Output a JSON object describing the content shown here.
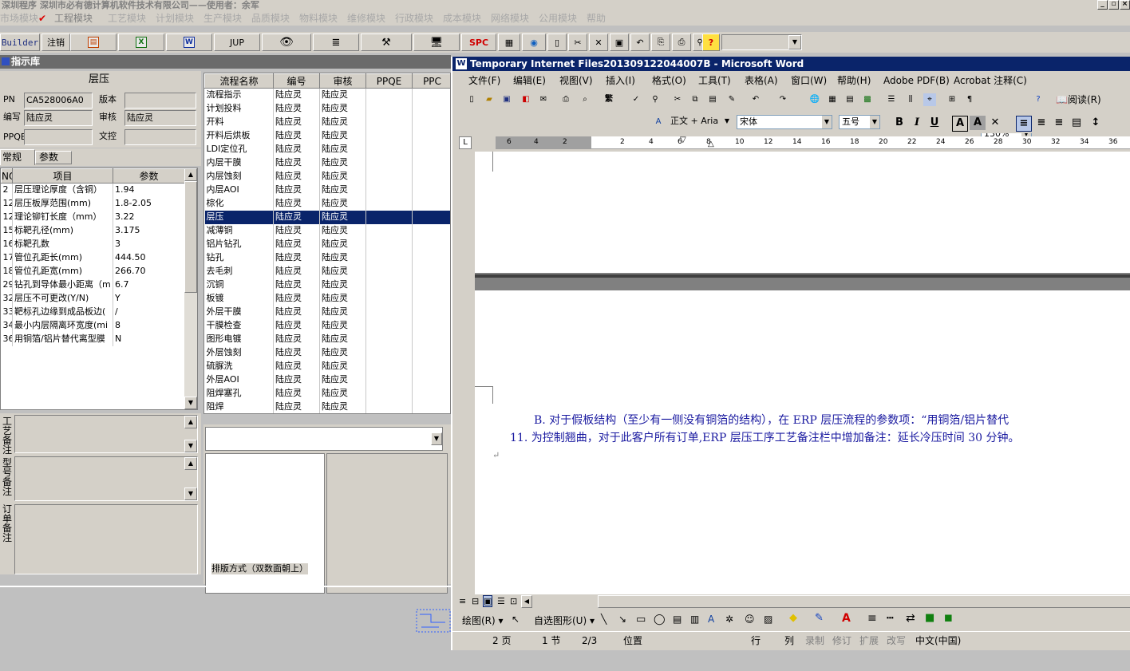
{
  "app": {
    "title": "深圳程序    深圳市必有德计算机软件技术有限公司——使用者：余军",
    "modules": [
      "市场模块",
      "工程模块",
      "工艺模块",
      "计划模块",
      "生产模块",
      "品质模块",
      "物料模块",
      "维修模块",
      "行政模块",
      "成本模块",
      "网络模块",
      "公用模块",
      "帮助"
    ]
  },
  "toolbar": {
    "builder": "Builder",
    "logout": "注销",
    "jup": "JUP",
    "spc": "SPC"
  },
  "library": {
    "title": "指示库",
    "section_title": "层压",
    "fields": {
      "pn_label": "PN",
      "pn_value": "CA528006A0",
      "version_label": "版本",
      "version_value": "",
      "author_label": "编写",
      "author_value": "陆应灵",
      "review_label": "审核",
      "review_value": "陆应灵",
      "ppqe_label": "PPQE",
      "ppqe_value": "",
      "doc_label": "文控",
      "doc_value": ""
    },
    "tabs": [
      "常规",
      "参数"
    ],
    "param_headers": [
      "NO",
      "项目",
      "参数"
    ],
    "params": [
      {
        "no": "2",
        "item": "层压理论厚度（含铜）",
        "value": "1.94"
      },
      {
        "no": "12",
        "item": "层压板厚范围(mm)",
        "value": "1.8-2.05"
      },
      {
        "no": "12",
        "item": "理论铆钉长度（mm）",
        "value": "3.22"
      },
      {
        "no": "15",
        "item": "标靶孔径(mm)",
        "value": "3.175"
      },
      {
        "no": "16",
        "item": "标靶孔数",
        "value": "3"
      },
      {
        "no": "17",
        "item": "管位孔距长(mm)",
        "value": "444.50"
      },
      {
        "no": "18",
        "item": "管位孔距宽(mm)",
        "value": "266.70"
      },
      {
        "no": "29",
        "item": "钻孔到导体最小距离（m",
        "value": "6.7"
      },
      {
        "no": "32",
        "item": "层压不可更改(Y/N)",
        "value": "Y"
      },
      {
        "no": "33",
        "item": "靶标孔边缘到成品板边(",
        "value": "/"
      },
      {
        "no": "34",
        "item": "最小内层隔离环宽度(mi",
        "value": "8"
      },
      {
        "no": "36",
        "item": "用铜箔/铝片替代离型膜",
        "value": "N"
      }
    ],
    "remarks": [
      "工艺备注",
      "型号备注",
      "订单备注"
    ],
    "flow_headers": [
      "流程名称",
      "编号",
      "审核",
      "PPQE",
      "PPC"
    ],
    "flows": [
      {
        "name": "流程指示",
        "code": "陆应灵",
        "review": "陆应灵"
      },
      {
        "name": "计划投料",
        "code": "陆应灵",
        "review": "陆应灵"
      },
      {
        "name": "开料",
        "code": "陆应灵",
        "review": "陆应灵"
      },
      {
        "name": "开料后烘板",
        "code": "陆应灵",
        "review": "陆应灵"
      },
      {
        "name": "LDI定位孔",
        "code": "陆应灵",
        "review": "陆应灵"
      },
      {
        "name": "内层干膜",
        "code": "陆应灵",
        "review": "陆应灵"
      },
      {
        "name": "内层蚀刻",
        "code": "陆应灵",
        "review": "陆应灵"
      },
      {
        "name": "内层AOI",
        "code": "陆应灵",
        "review": "陆应灵"
      },
      {
        "name": "棕化",
        "code": "陆应灵",
        "review": "陆应灵"
      },
      {
        "name": "层压",
        "code": "陆应灵",
        "review": "陆应灵"
      },
      {
        "name": "减薄铜",
        "code": "陆应灵",
        "review": "陆应灵"
      },
      {
        "name": "铝片钻孔",
        "code": "陆应灵",
        "review": "陆应灵"
      },
      {
        "name": "钻孔",
        "code": "陆应灵",
        "review": "陆应灵"
      },
      {
        "name": "去毛刺",
        "code": "陆应灵",
        "review": "陆应灵"
      },
      {
        "name": "沉铜",
        "code": "陆应灵",
        "review": "陆应灵"
      },
      {
        "name": "板镀",
        "code": "陆应灵",
        "review": "陆应灵"
      },
      {
        "name": "外层干膜",
        "code": "陆应灵",
        "review": "陆应灵"
      },
      {
        "name": "干膜检查",
        "code": "陆应灵",
        "review": "陆应灵"
      },
      {
        "name": "图形电镀",
        "code": "陆应灵",
        "review": "陆应灵"
      },
      {
        "name": "外层蚀刻",
        "code": "陆应灵",
        "review": "陆应灵"
      },
      {
        "name": "硫脲洗",
        "code": "陆应灵",
        "review": "陆应灵"
      },
      {
        "name": "外层AOI",
        "code": "陆应灵",
        "review": "陆应灵"
      },
      {
        "name": "阻焊塞孔",
        "code": "陆应灵",
        "review": "陆应灵"
      },
      {
        "name": "阻焊",
        "code": "陆应灵",
        "review": "陆应灵"
      }
    ],
    "layout_caption": "排版方式（双数面朝上）"
  },
  "word": {
    "title": "Temporary Internet Files201309122044007B - Microsoft Word",
    "menu": [
      "文件(F)",
      "编辑(E)",
      "视图(V)",
      "插入(I)",
      "格式(O)",
      "工具(T)",
      "表格(A)",
      "窗口(W)",
      "帮助(H)",
      "Adobe PDF(B)",
      "Acrobat 注释(C)"
    ],
    "zoom": "130%",
    "read_label": "阅读(R)",
    "style": "正文 + Aria",
    "font": "宋体",
    "size": "五号",
    "ruler_marks": [
      "6",
      "4",
      "2",
      "2",
      "4",
      "6",
      "8",
      "10",
      "12",
      "14",
      "16",
      "18",
      "20",
      "22",
      "24",
      "26",
      "28",
      "30",
      "32",
      "34",
      "36"
    ],
    "doc_line1": "B.  对于假板结构（至少有一侧没有铜箔的结构），在 ERP 层压流程的参数项：“用铜箔/铝片替代",
    "doc_line2": "11.  为控制翘曲，对于此客户所有订单,ERP 层压工序工艺备注栏中增加备注：延长冷压时间 30 分钟。",
    "paragraph_mark": "↵",
    "draw_label": "绘图(R)",
    "autoshape_label": "自选图形(U)",
    "status": {
      "page": "2 页",
      "section": "1 节",
      "pages": "2/3",
      "position": "位置",
      "line": "行",
      "col": "列",
      "rec": "录制",
      "trk": "修订",
      "ext": "扩展",
      "ovr": "改写",
      "lang": "中文(中国)"
    }
  }
}
